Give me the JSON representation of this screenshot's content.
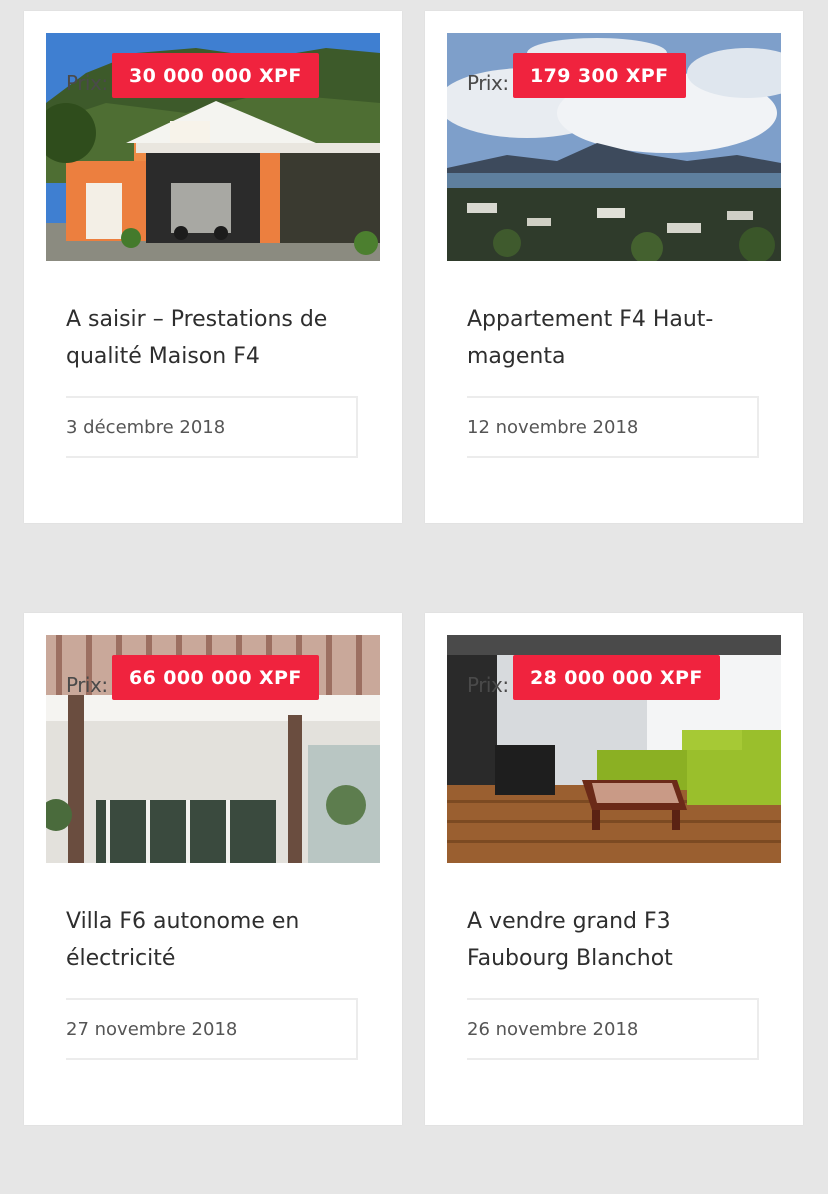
{
  "prix_label": "Prix:",
  "accent_color": "#f0233e",
  "listings": [
    {
      "price": "30 000 000 XPF",
      "title": "A saisir – Prestations de qualité Maison F4",
      "date": "3 décembre 2018",
      "image": "orange-house-photo"
    },
    {
      "price": "179 300 XPF",
      "title": "Appartement F4 Haut-magenta",
      "date": "12 novembre 2018",
      "image": "bay-view-photo"
    },
    {
      "price": "66 000 000 XPF",
      "title": "Villa F6 autonome en électricité",
      "date": "27 novembre 2018",
      "image": "villa-terrace-photo"
    },
    {
      "price": "28 000 000 XPF",
      "title": "A vendre grand F3 Faubourg Blanchot",
      "date": "26 novembre 2018",
      "image": "living-room-photo"
    }
  ]
}
